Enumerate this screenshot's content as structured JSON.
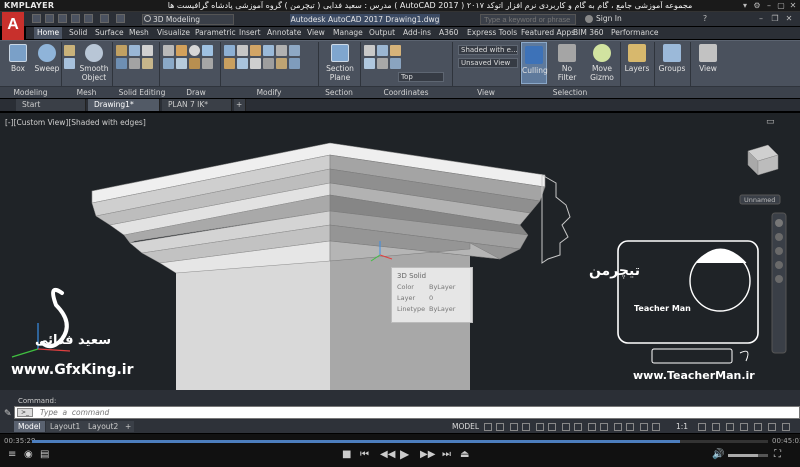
{
  "player": {
    "logo": "KMPLAYER",
    "title": "مجموعه آموزشی جامع ، گام به گام و کاربردی نرم افزار  اتوکد ۲۰۱۷ ( AutoCAD 2017 )  مدرس : سعید فدایی ( تیچرمن ) گروه آموزشی پادشاه گرافیست ها",
    "time_elapsed": "00:35:29",
    "time_total": "00:45:03",
    "progress": 0.88,
    "volume": 0.75
  },
  "app": {
    "logo_letter": "A",
    "workspace": "3D Modeling",
    "doc_title": "Autodesk AutoCAD 2017    Drawing1.dwg",
    "search_placeholder": "Type a keyword or phrase",
    "signin": "Sign In"
  },
  "ribbon_tabs": [
    "Home",
    "Solid",
    "Surface",
    "Mesh",
    "Visualize",
    "Parametric",
    "Insert",
    "Annotate",
    "View",
    "Manage",
    "Output",
    "Add-ins",
    "A360",
    "Express Tools",
    "Featured Apps",
    "BIM 360",
    "Performance"
  ],
  "ribbon": {
    "box": "Box",
    "sweep": "Sweep",
    "smooth_object": "Smooth Object",
    "section_plane": "Section Plane",
    "shaded": "Shaded with e...",
    "unsaved_view": "Unsaved View",
    "top": "Top",
    "culling": "Culling",
    "no_filter": "No Filter",
    "move_gizmo": "Move Gizmo",
    "layers": "Layers",
    "groups": "Groups",
    "view": "View",
    "panels": {
      "modeling": "Modeling",
      "mesh": "Mesh",
      "solid_editing": "Solid Editing",
      "draw": "Draw",
      "modify": "Modify",
      "section": "Section",
      "coordinates": "Coordinates",
      "view": "View",
      "selection": "Selection"
    }
  },
  "doc_tabs": [
    "Start",
    "Drawing1*",
    "PLAN 7 IK*"
  ],
  "viewport": {
    "label": "[-][Custom View][Shaded with edges]",
    "viewcube_label": "Unnamed"
  },
  "tooltip": {
    "title": "3D Solid",
    "rows": [
      {
        "k": "Color",
        "v": "ByLayer"
      },
      {
        "k": "Layer",
        "v": "0"
      },
      {
        "k": "Linetype",
        "v": "ByLayer"
      }
    ]
  },
  "watermarks": {
    "gfx_name": "سعید فدائی",
    "gfx_url": "www.GfxKing.ir",
    "tm_url": "www.TeacherMan.ir",
    "tm_brand": "Teacher Man",
    "tm_fa": "تیچرمن"
  },
  "command": {
    "history": "Command:",
    "placeholder": "Type  a  command"
  },
  "layout_tabs": [
    "Model",
    "Layout1",
    "Layout2"
  ],
  "status": {
    "model": "MODEL",
    "scale": "1:1"
  },
  "colors": {
    "accent_blue": "#4d7fbf",
    "acad_red": "#c8302c"
  }
}
